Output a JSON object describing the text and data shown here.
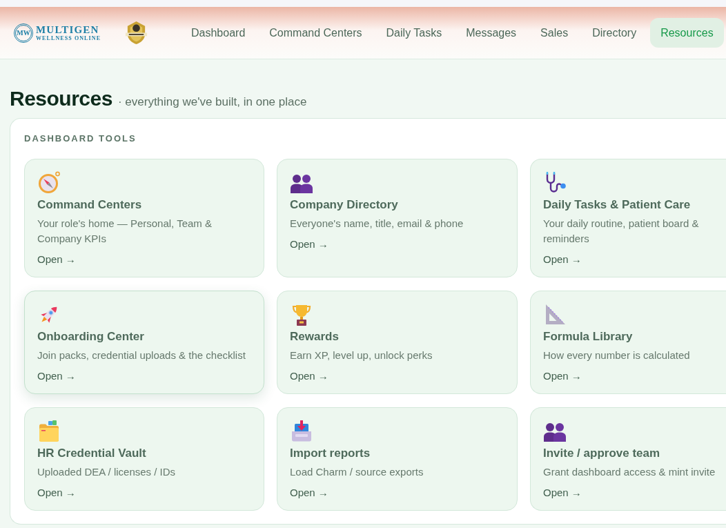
{
  "header": {
    "brand": {
      "monogram": "MW",
      "name": "MULTIGEN",
      "tagline": "WELLNESS ONLINE"
    },
    "nav": [
      {
        "label": "Dashboard",
        "selected": false
      },
      {
        "label": "Command Centers",
        "selected": false
      },
      {
        "label": "Daily Tasks",
        "selected": false
      },
      {
        "label": "Messages",
        "selected": false
      },
      {
        "label": "Sales",
        "selected": false
      },
      {
        "label": "Directory",
        "selected": false
      },
      {
        "label": "Resources",
        "selected": true
      }
    ]
  },
  "page": {
    "title": "Resources",
    "subtitle": "· everything we've built, in one place"
  },
  "tools": {
    "heading": "DASHBOARD TOOLS",
    "cards": [
      {
        "title": "Command Centers",
        "description": "Your role's home — Personal, Team & Company KPIs",
        "link": "Open →",
        "highlighted": false
      },
      {
        "title": "Company Directory",
        "description": "Everyone's name, title, email & phone",
        "link": "Open →",
        "highlighted": false
      },
      {
        "title": "Daily Tasks & Patient Care",
        "description": "Your daily routine, patient board & reminders",
        "link": "Open →",
        "highlighted": false
      },
      {
        "title": "Onboarding Center",
        "description": "Join packs, credential uploads & the checklist",
        "link": "Open →",
        "highlighted": true
      },
      {
        "title": "Rewards",
        "description": "Earn XP, level up, unlock perks",
        "link": "Open →",
        "highlighted": false
      },
      {
        "title": "Formula Library",
        "description": "How every number is calculated",
        "link": "Open →",
        "highlighted": false
      },
      {
        "title": "HR Credential Vault",
        "description": "Uploaded DEA / licenses / IDs",
        "link": "Open →",
        "highlighted": false
      },
      {
        "title": "Import reports",
        "description": "Load Charm / source exports",
        "link": "Open →",
        "highlighted": false
      },
      {
        "title": "Invite / approve team",
        "description": "Grant dashboard access & mint invite",
        "link": "Open →",
        "highlighted": false
      }
    ]
  }
}
